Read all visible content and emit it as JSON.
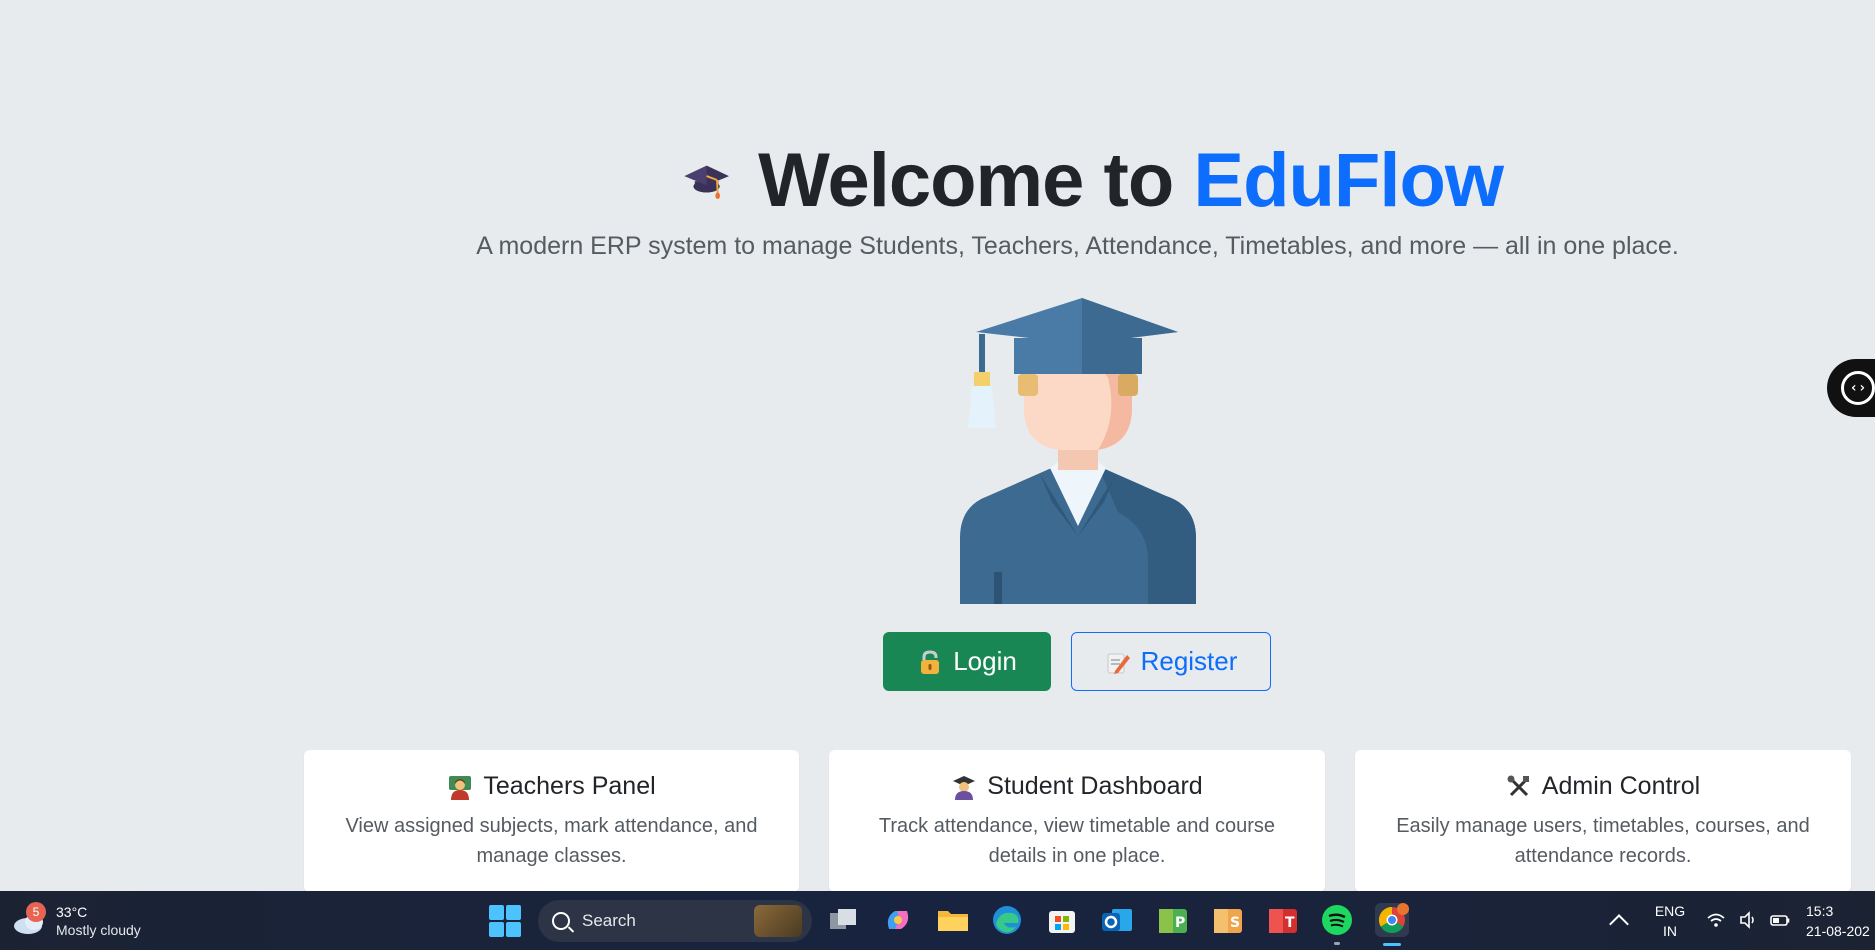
{
  "hero": {
    "title_prefix": "Welcome to ",
    "title_brand": "EduFlow",
    "subtitle": "A modern ERP system to manage Students, Teachers, Attendance, Timetables, and more — all in one place."
  },
  "buttons": {
    "login_label": "Login",
    "register_label": "Register"
  },
  "cards": [
    {
      "title": "Teachers Panel",
      "text": "View assigned subjects, mark attendance, and manage classes.",
      "icon": "teacher-emoji"
    },
    {
      "title": "Student Dashboard",
      "text": "Track attendance, view timetable and course details in one place.",
      "icon": "student-emoji"
    },
    {
      "title": "Admin Control",
      "text": "Easily manage users, timetables, courses, and attendance records.",
      "icon": "tools-emoji"
    }
  ],
  "taskbar": {
    "weather_temp": "33°C",
    "weather_condition": "Mostly cloudy",
    "weather_badge": "5",
    "search_placeholder": "Search",
    "lang_line1": "ENG",
    "lang_line2": "IN",
    "time": "15:3",
    "date": "21-08-202"
  },
  "colors": {
    "brand": "#0d6efd",
    "login": "#198754",
    "background": "#e8ebee"
  }
}
